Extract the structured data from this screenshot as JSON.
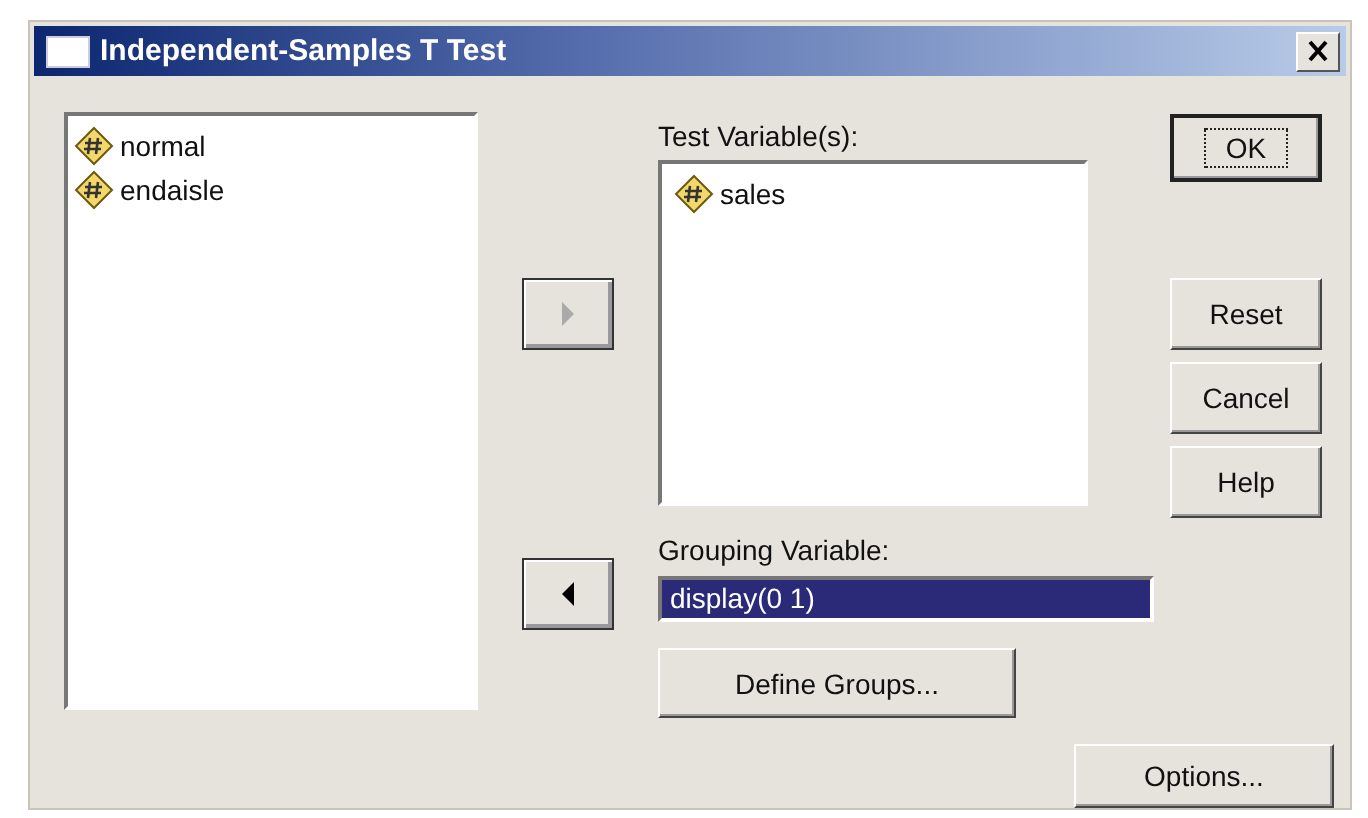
{
  "window": {
    "title": "Independent-Samples T Test"
  },
  "source_list": {
    "items": [
      "normal",
      "endaisle"
    ]
  },
  "arrow_buttons": [
    {
      "kind": "right",
      "disabled": true
    },
    {
      "kind": "left",
      "disabled": false
    }
  ],
  "test_variables": {
    "label": "Test Variable(s):",
    "items": [
      "sales"
    ]
  },
  "grouping": {
    "label": "Grouping Variable:",
    "value": "display(0 1)",
    "selected": true
  },
  "define_groups": "Define Groups...",
  "side_buttons": [
    {
      "label": "OK",
      "default": true
    },
    {
      "label": "Reset",
      "default": false
    },
    {
      "label": "Cancel",
      "default": false
    },
    {
      "label": "Help",
      "default": false
    }
  ],
  "options_button": "Options..."
}
